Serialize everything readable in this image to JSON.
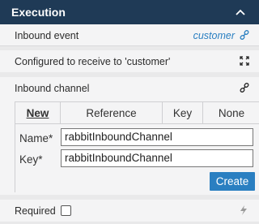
{
  "header": {
    "title": "Execution",
    "collapse_icon": "chevron-up-icon"
  },
  "inbound_event": {
    "label": "Inbound event",
    "value": "customer",
    "icon": "link-icon"
  },
  "configured": {
    "text": "Configured to receive to 'customer'",
    "icon": "expand-icon"
  },
  "inbound_channel": {
    "label": "Inbound channel",
    "icon": "link-icon",
    "tabs": [
      {
        "label": "New",
        "active": true
      },
      {
        "label": "Reference",
        "active": false
      },
      {
        "label": "Key",
        "active": false
      },
      {
        "label": "None",
        "active": false
      }
    ],
    "fields": {
      "name_label": "Name*",
      "name_value": "rabbitInboundChannel",
      "key_label": "Key*",
      "key_value": "rabbitInboundChannel"
    },
    "create_label": "Create"
  },
  "required": {
    "label": "Required",
    "checked": false,
    "icon": "bolt-icon"
  },
  "colors": {
    "header_bg": "#1f3a56",
    "accent": "#2a7fc1",
    "panel_bg": "#f4f4f5",
    "page_bg": "#e9e9ea"
  }
}
